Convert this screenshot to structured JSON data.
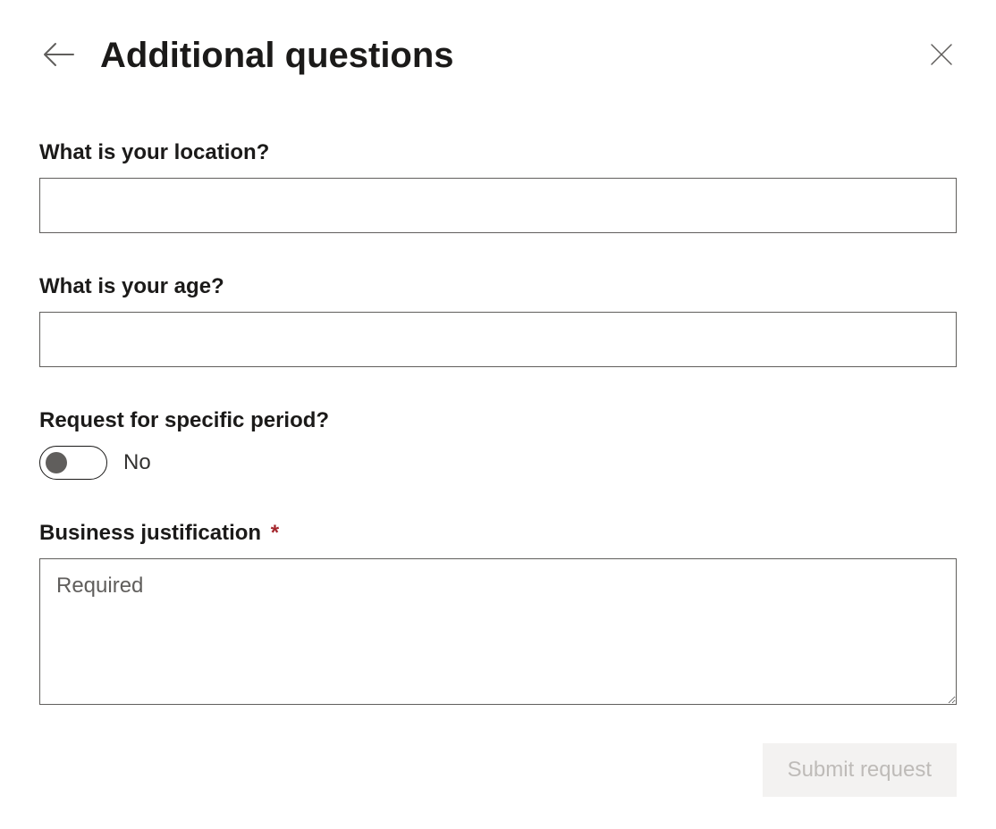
{
  "header": {
    "title": "Additional questions"
  },
  "fields": {
    "location": {
      "label": "What is your location?",
      "value": ""
    },
    "age": {
      "label": "What is your age?",
      "value": ""
    },
    "period": {
      "label": "Request for specific period?",
      "toggle_state": "No"
    },
    "justification": {
      "label": "Business justification",
      "required_mark": "*",
      "placeholder": "Required",
      "value": ""
    }
  },
  "actions": {
    "submit_label": "Submit request"
  }
}
